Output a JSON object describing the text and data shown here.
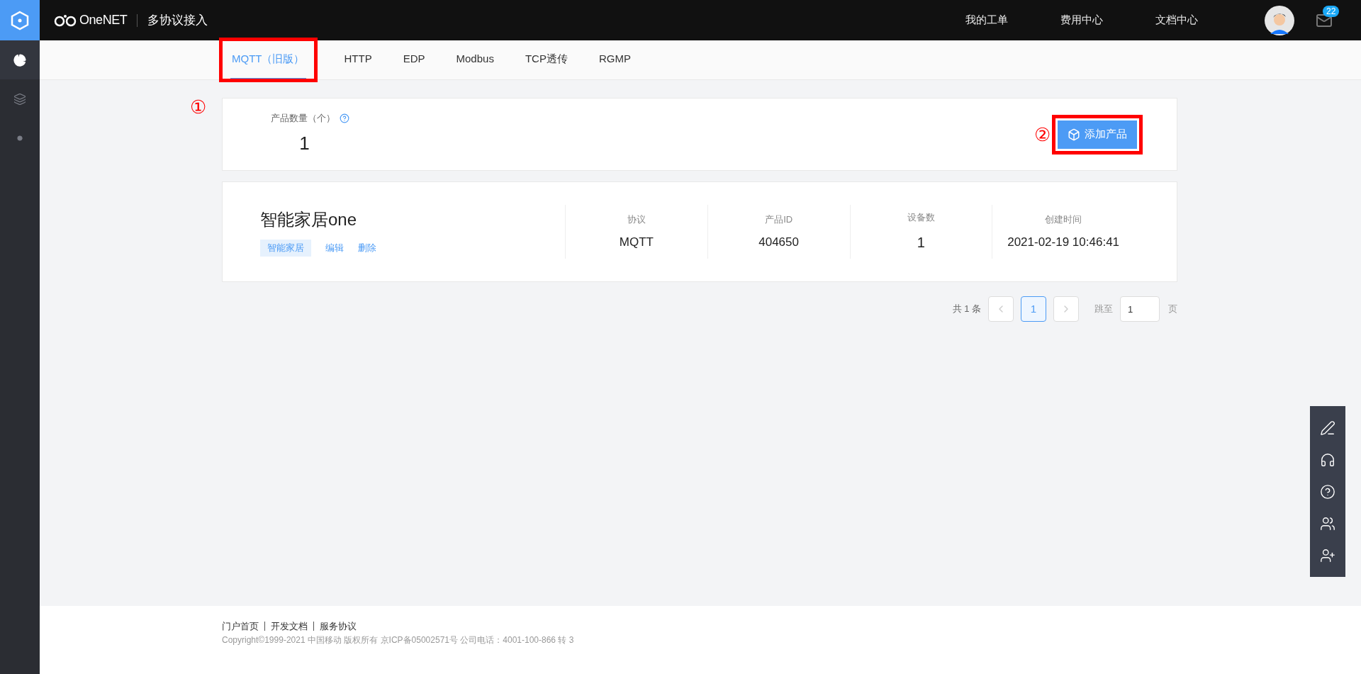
{
  "header": {
    "logo_text": "OneNET",
    "title": "多协议接入",
    "links": [
      "我的工单",
      "费用中心",
      "文档中心"
    ],
    "message_count": "22"
  },
  "sidebar": {
    "items": [
      {
        "selected": true
      },
      {
        "selected": false
      },
      {
        "selected": false
      }
    ]
  },
  "tabs": [
    {
      "label": "MQTT（旧版）",
      "selected": true,
      "annotated": true
    },
    {
      "label": "HTTP",
      "selected": false,
      "annotated": false
    },
    {
      "label": "EDP",
      "selected": false,
      "annotated": false
    },
    {
      "label": "Modbus",
      "selected": false,
      "annotated": false
    },
    {
      "label": "TCP透传",
      "selected": false,
      "annotated": false
    },
    {
      "label": "RGMP",
      "selected": false,
      "annotated": false
    }
  ],
  "annotations": [
    "①",
    "②"
  ],
  "summary": {
    "label": "产品数量（个）",
    "value": "1",
    "add_button": "添加产品"
  },
  "products": [
    {
      "name": "智能家居one",
      "tag": "智能家居",
      "actions": [
        "编辑",
        "删除"
      ],
      "fields": [
        {
          "label": "协议",
          "value": "MQTT"
        },
        {
          "label": "产品ID",
          "value": "404650"
        },
        {
          "label": "设备数",
          "value": "1"
        },
        {
          "label": "创建时间",
          "value": "2021-02-19 10:46:41"
        }
      ]
    }
  ],
  "pagination": {
    "total": "共 1 条",
    "pages": [
      {
        "label": "1",
        "selected": true
      }
    ],
    "jump_label": "跳至",
    "jump_value": "1",
    "page_unit": "页"
  },
  "footer": {
    "links": [
      "门户首页",
      "开发文档",
      "服务协议"
    ],
    "copyright": "Copyright©1999-2021 中国移动 版权所有 京ICP备05002571号 公司电话：4001-100-866 转 3"
  }
}
